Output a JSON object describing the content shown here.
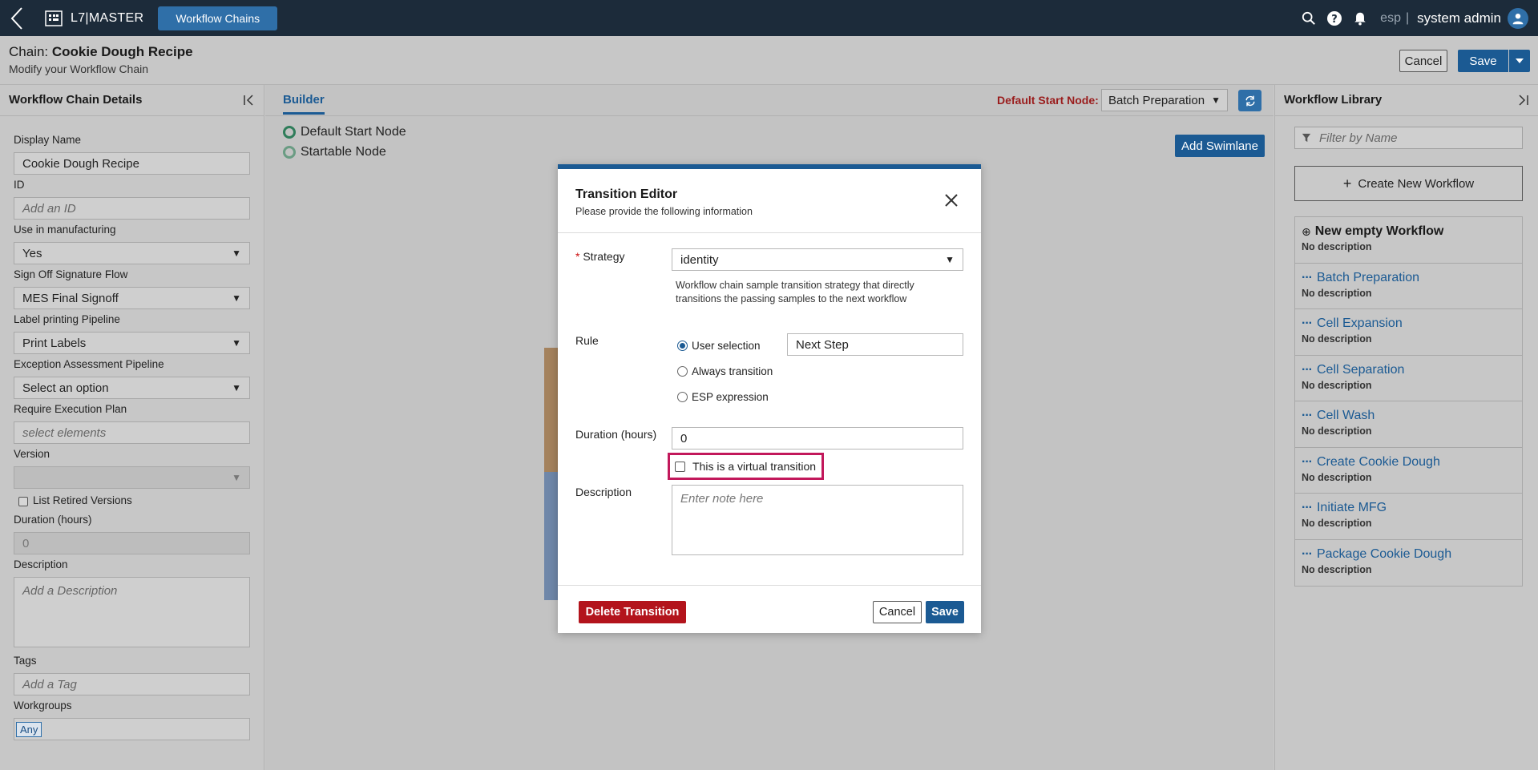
{
  "nav": {
    "brand": "L7|MASTER",
    "active_tab": "Workflow Chains",
    "lang": "esp",
    "separator": "|",
    "user": "system admin",
    "icons": [
      "back-chevron-icon",
      "search-icon",
      "help-icon",
      "bell-icon",
      "user-avatar-icon"
    ]
  },
  "header": {
    "chain_prefix": "Chain: ",
    "chain_name": "Cookie Dough Recipe",
    "subtitle": "Modify your Workflow Chain",
    "cancel_label": "Cancel",
    "save_label": "Save"
  },
  "left_panel": {
    "title": "Workflow Chain Details",
    "display_name_label": "Display Name",
    "display_name_value": "Cookie Dough Recipe",
    "id_label": "ID",
    "id_placeholder": "Add an ID",
    "use_in_mfg_label": "Use in manufacturing",
    "use_in_mfg_value": "Yes",
    "signoff_label": "Sign Off Signature Flow",
    "signoff_value": "MES Final Signoff",
    "label_printing_label": "Label printing Pipeline",
    "label_printing_value": "Print Labels",
    "exception_label": "Exception Assessment Pipeline",
    "exception_value": "Select an option",
    "exec_plan_label": "Require Execution Plan",
    "exec_plan_placeholder": "select elements",
    "version_label": "Version",
    "version_value": "",
    "list_retired_label": "List Retired Versions",
    "duration_label": "Duration (hours)",
    "duration_value": "0",
    "description_label": "Description",
    "description_placeholder": "Add a Description",
    "tags_label": "Tags",
    "tags_placeholder": "Add a Tag",
    "workgroups_label": "Workgroups",
    "workgroups_chip": "Any"
  },
  "builder": {
    "tab_label": "Builder",
    "default_start_label": "Default Start Node:",
    "default_start_value": "Batch Preparation",
    "legend_default": "Default Start Node",
    "legend_startable": "Startable Node",
    "add_swimlane_label": "Add Swimlane",
    "colors": {
      "swimlane_1": "#a4825d",
      "swimlane_2": "#6f87a9"
    }
  },
  "right_panel": {
    "title": "Workflow Library",
    "filter_placeholder": "Filter by Name",
    "create_label": "Create New Workflow",
    "items": [
      {
        "name": "New empty Workflow",
        "desc": "No description"
      },
      {
        "name": "Batch Preparation",
        "desc": "No description"
      },
      {
        "name": "Cell Expansion",
        "desc": "No description"
      },
      {
        "name": "Cell Separation",
        "desc": "No description"
      },
      {
        "name": "Cell Wash",
        "desc": "No description"
      },
      {
        "name": "Create Cookie Dough",
        "desc": "No description"
      },
      {
        "name": "Initiate MFG",
        "desc": "No description"
      },
      {
        "name": "Package Cookie Dough",
        "desc": "No description"
      }
    ]
  },
  "modal": {
    "title": "Transition Editor",
    "subtitle": "Please provide the following information",
    "strategy_required_mark": "*",
    "strategy_label": "Strategy",
    "strategy_value": "identity",
    "strategy_help": "Workflow chain sample transition strategy that directly transitions the passing samples to the next workflow",
    "rule_label": "Rule",
    "rule_options": [
      "User selection",
      "Always transition",
      "ESP expression"
    ],
    "rule_selected": "User selection",
    "user_selection_value": "Next Step",
    "duration_label": "Duration (hours)",
    "duration_value": "0",
    "virtual_label": "This is a virtual transition",
    "description_label": "Description",
    "description_placeholder": "Enter note here",
    "delete_label": "Delete Transition",
    "cancel_label": "Cancel",
    "save_label": "Save",
    "colors": {
      "accent": "#1b5a93",
      "danger": "#b3141c",
      "highlight": "#c2185b"
    }
  }
}
